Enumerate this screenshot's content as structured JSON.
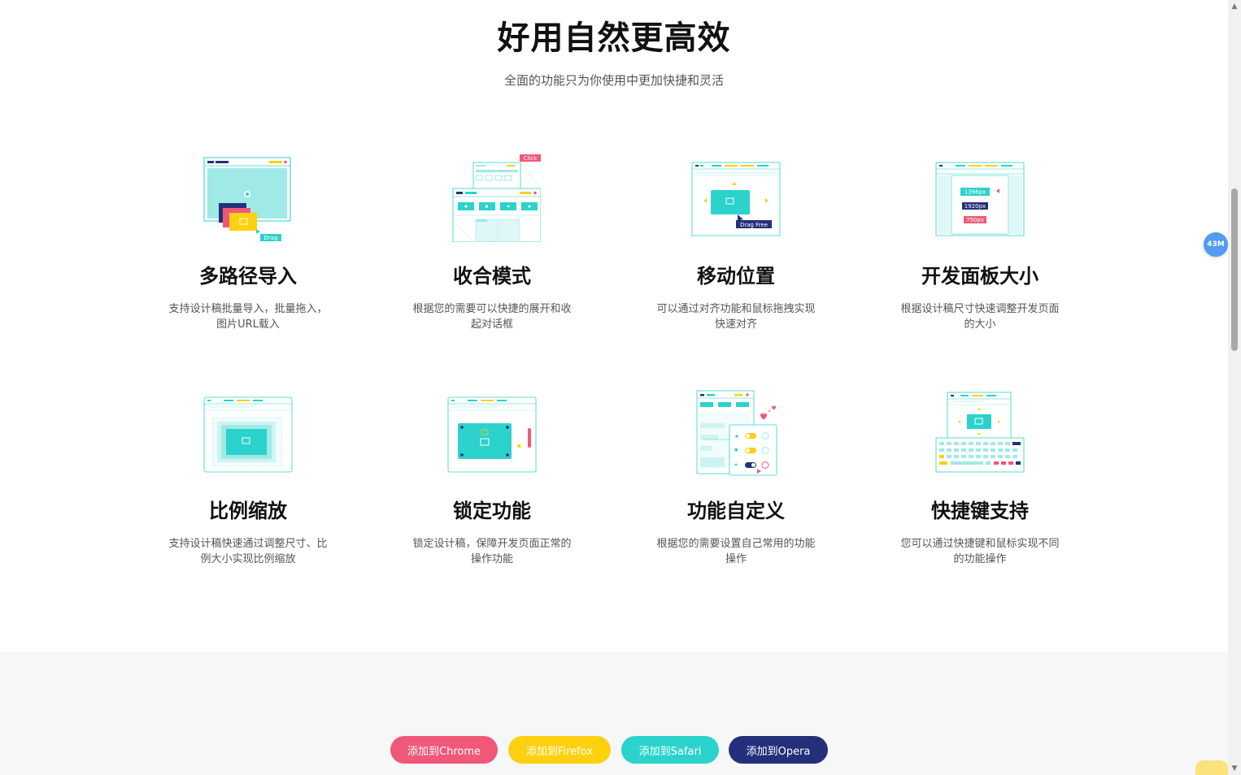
{
  "hero": {
    "title": "好用自然更高效",
    "subtitle": "全面的功能只为你使用中更加快捷和灵活"
  },
  "features": [
    {
      "title": "多路径导入",
      "desc": "支持设计稿批量导入，批量拖入，图片URL载入",
      "icon": "multi-path-import-illustration"
    },
    {
      "title": "收合模式",
      "desc": "根据您的需要可以快捷的展开和收起对话框",
      "icon": "collapse-mode-illustration"
    },
    {
      "title": "移动位置",
      "desc": "可以通过对齐功能和鼠标拖拽实现快速对齐",
      "icon": "move-position-illustration"
    },
    {
      "title": "开发面板大小",
      "desc": "根据设计稿尺寸快速调整开发页面的大小",
      "icon": "panel-size-illustration"
    },
    {
      "title": "比例缩放",
      "desc": "支持设计稿快速通过调整尺寸、比例大小实现比例缩放",
      "icon": "scale-illustration"
    },
    {
      "title": "锁定功能",
      "desc": "锁定设计稿，保障开发页面正常的操作功能",
      "icon": "lock-illustration"
    },
    {
      "title": "功能自定义",
      "desc": "根据您的需要设置自己常用的功能操作",
      "icon": "customize-illustration"
    },
    {
      "title": "快捷键支持",
      "desc": "您可以通过快捷键和鼠标实现不同的功能操作",
      "icon": "shortcut-illustration"
    }
  ],
  "illustration_labels": {
    "drag": "Drag",
    "click": "Click",
    "drag_free": "Drag Free",
    "size_1366": "1366px",
    "size_1920": "1920px",
    "size_750": "750px"
  },
  "buttons": [
    {
      "label": "添加到Chrome",
      "color": "#f0587a"
    },
    {
      "label": "添加到Firefox",
      "color": "#fdd10f"
    },
    {
      "label": "添加到Safari",
      "color": "#2cd2cc"
    },
    {
      "label": "添加到Opera",
      "color": "#24307a"
    }
  ],
  "memory_badge": "43M",
  "colors": {
    "teal": "#2cd2cc",
    "light_teal": "#9feae6",
    "navy": "#24307a",
    "pink": "#f0587a",
    "yellow": "#fdd10f"
  }
}
